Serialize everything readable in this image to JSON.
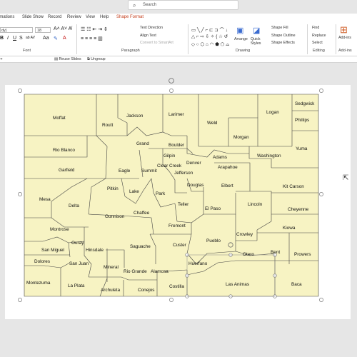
{
  "search": {
    "placeholder": "Search"
  },
  "tabs": [
    "imations",
    "Slide Show",
    "Record",
    "Review",
    "View",
    "Help",
    "Shape Format"
  ],
  "ribbon": {
    "font_name": "dy)",
    "font_size": "18",
    "groups": [
      "Font",
      "Paragraph",
      "Drawing",
      "Editing",
      "Add-ins"
    ],
    "text_direction": "Text Direction",
    "align_text": "Align Text",
    "convert_smartart": "Convert to SmartArt",
    "arrange": "Arrange",
    "quick_styles": "Quick Styles",
    "shape_fill": "Shape Fill",
    "shape_outline": "Shape Outline",
    "shape_effects": "Shape Effects",
    "find": "Find",
    "replace": "Replace",
    "select": "Select",
    "add_ins": "Add-ins"
  },
  "subbar": {
    "reuse_slides": "Reuse Slides",
    "ungroup": "Ungroup"
  },
  "colors": {
    "county_fill": "#f7f3c3",
    "border": "#444444",
    "accent": "#c43e1c"
  },
  "counties": [
    "Moffat",
    "Routt",
    "Jackson",
    "Larimer",
    "Logan",
    "Sedgwick",
    "Phillips",
    "Weld",
    "Morgan",
    "Rio Blanco",
    "Grand",
    "Boulder",
    "Gilpin",
    "Denver",
    "Adams",
    "Washington",
    "Yuma",
    "Garfield",
    "Eagle",
    "Summit",
    "Clear Creek",
    "Jefferson",
    "Arapahoe",
    "Mesa",
    "Pitkin",
    "Lake",
    "Park",
    "Douglas",
    "Elbert",
    "Kit Carson",
    "Delta",
    "Chaffee",
    "Teller",
    "El Paso",
    "Lincoln",
    "Cheyenne",
    "Gunnison",
    "Fremont",
    "Kiowa",
    "Montrose",
    "Crowley",
    "Ouray",
    "Hinsdale",
    "Saguache",
    "Custer",
    "Pueblo",
    "San Miguel",
    "San Juan",
    "Otero",
    "Bent",
    "Prowers",
    "Dolores",
    "Mineral",
    "Rio Grande",
    "Alamosa",
    "Huerfano",
    "Montezuma",
    "La Plata",
    "Archuleta",
    "Conejos",
    "Costilla",
    "Las Animas",
    "Baca"
  ]
}
